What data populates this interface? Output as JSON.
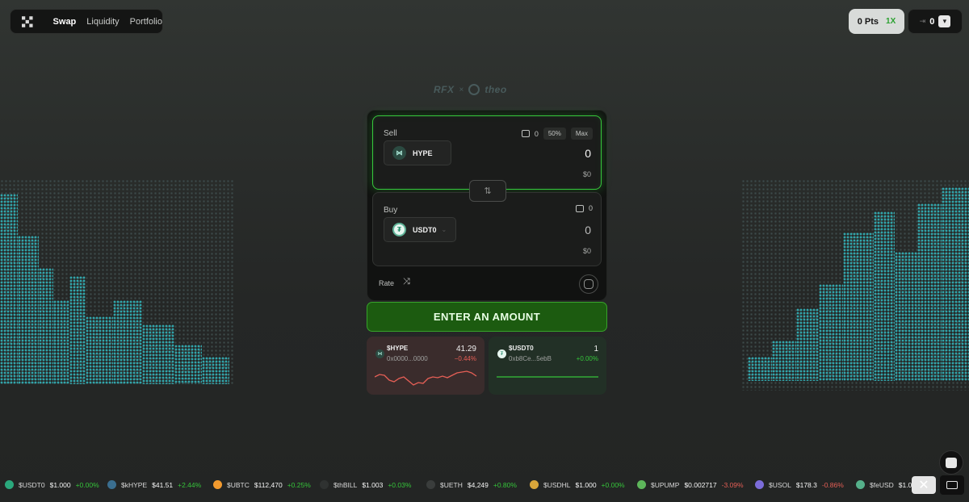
{
  "nav": {
    "logo_icon": "rfx-logo-icon",
    "links": [
      "Swap",
      "Liquidity",
      "Portfolio"
    ],
    "active": "Swap"
  },
  "points": {
    "label": "0 Pts",
    "multiplier": "1X"
  },
  "wallet": {
    "count": "0",
    "icon": "link-icon",
    "chevron": "chevron-down-icon"
  },
  "partners": {
    "left": "RFX",
    "separator": "×",
    "right": "theo"
  },
  "swap": {
    "sell": {
      "label": "Sell",
      "balance": "0",
      "pct_50": "50%",
      "max": "Max",
      "token": "HYPE",
      "amount_placeholder": "0",
      "usd": "$0"
    },
    "buy": {
      "label": "Buy",
      "balance": "0",
      "token": "USDT0",
      "amount_placeholder": "0",
      "usd": "$0"
    },
    "flip_icon": "swap-arrows-icon",
    "rate_label": "Rate",
    "rate_icon": "swap-direction-icon",
    "settings_icon": "settings-icon",
    "cta": "ENTER AN AMOUNT"
  },
  "price_cards": [
    {
      "symbol": "$HYPE",
      "address": "0x0000...0000",
      "price": "41.29",
      "change": "−0.44%",
      "trend": "neg"
    },
    {
      "symbol": "$USDT0",
      "address": "0xb8Ce...5ebB",
      "price": "1",
      "change": "+0.00%",
      "trend": "pos"
    }
  ],
  "ticker": [
    {
      "symbol": "$USDT0",
      "price": "$1.000",
      "change": "+0.00%",
      "trend": "pos",
      "color": "#2aa87c"
    },
    {
      "symbol": "$kHYPE",
      "price": "$41.51",
      "change": "+2.44%",
      "trend": "pos",
      "color": "#3a6e8f"
    },
    {
      "symbol": "$UBTC",
      "price": "$112,470",
      "change": "+0.25%",
      "trend": "pos",
      "color": "#f29a2e"
    },
    {
      "symbol": "$thBILL",
      "price": "$1.003",
      "change": "+0.03%",
      "trend": "pos",
      "color": "#2f3231"
    },
    {
      "symbol": "$UETH",
      "price": "$4,249",
      "change": "+0.80%",
      "trend": "pos",
      "color": "#3a3d3c"
    },
    {
      "symbol": "$USDHL",
      "price": "$1.000",
      "change": "+0.00%",
      "trend": "pos",
      "color": "#d9a63a"
    },
    {
      "symbol": "$UPUMP",
      "price": "$0.002717",
      "change": "-3.09%",
      "trend": "neg",
      "color": "#5db55a"
    },
    {
      "symbol": "$USOL",
      "price": "$178.3",
      "change": "-0.86%",
      "trend": "neg",
      "color": "#7b6cd9"
    },
    {
      "symbol": "$feUSD",
      "price": "$1.00",
      "change": "",
      "trend": "pos",
      "color": "#55b08a"
    }
  ],
  "colors": {
    "accent_green": "#36c83b",
    "negative_red": "#e65f56",
    "city_teal": "#31a5ab"
  }
}
